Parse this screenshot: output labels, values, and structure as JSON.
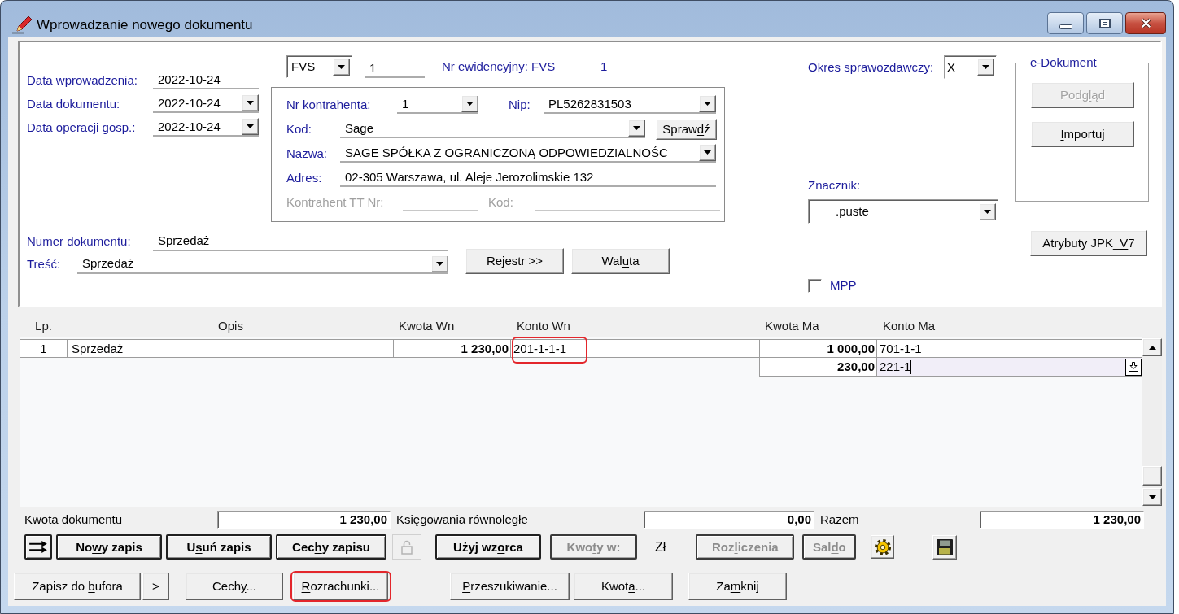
{
  "window": {
    "title": "Wprowadzanie nowego dokumentu"
  },
  "header": {
    "dates": [
      {
        "label": "Data wprowadzenia:",
        "value": "2022-10-24",
        "dropdown": false
      },
      {
        "label": "Data dokumentu:",
        "value": "2022-10-24",
        "dropdown": true
      },
      {
        "label": "Data operacji gosp.:",
        "value": "2022-10-24",
        "dropdown": true
      }
    ],
    "document_type": {
      "value": "FVS"
    },
    "document_no": {
      "value": "1"
    },
    "registry": {
      "label": "Nr ewidencyjny: FVS",
      "value": "1"
    },
    "contractor": {
      "number": {
        "label": "Nr kontrahenta:",
        "value": "1",
        "dropdown": true
      },
      "nip": {
        "label": "Nip:",
        "value": "PL5262831503",
        "dropdown": true
      },
      "code": {
        "label": "Kod:",
        "value": "Sage",
        "dropdown": true
      },
      "check_button": {
        "label": "Sprawdź"
      },
      "name": {
        "label": "Nazwa:",
        "value": "SAGE SPÓŁKA Z OGRANICZONĄ ODPOWIEDZIALNOŚC",
        "dropdown": true
      },
      "address": {
        "label": "Adres:",
        "value": "02-305 Warszawa, ul. Aleje Jerozolimskie 132",
        "dropdown": false
      },
      "tt_number": {
        "label": "Kontrahent TT Nr:",
        "disabled": true
      },
      "tt_code": {
        "label": "Kod:",
        "disabled": true
      }
    },
    "document_number": {
      "label": "Numer dokumentu:",
      "value": "Sprzedaż"
    },
    "content": {
      "label": "Treść:",
      "value": "Sprzedaż",
      "dropdown": true
    },
    "buttons": [
      {
        "label": "Rejestr >>"
      },
      {
        "label": "Waluta"
      }
    ],
    "period": {
      "label": "Okres sprawozdawczy:",
      "value": "X"
    },
    "e_document": {
      "title": "e-Dokument",
      "buttons": [
        {
          "label": "Podgląd",
          "disabled": true
        },
        {
          "label": "Importuj",
          "disabled": false
        }
      ]
    },
    "marker": {
      "label": "Znacznik:",
      "value": ".puste"
    },
    "jpk_button": {
      "label": "Atrybuty JPK_V7"
    },
    "mpp": {
      "label": "MPP",
      "checked": false
    }
  },
  "table": {
    "columns": [
      "Lp.",
      "Opis",
      "Kwota Wn",
      "Konto Wn",
      "Kwota Ma",
      "Konto Ma"
    ],
    "rows": [
      {
        "lp": "1",
        "opis": "Sprzedaż",
        "kwota_wn": "1 230,00",
        "konto_wn": "201-1-1-1",
        "highlighted": true,
        "credits": [
          {
            "kwota_ma": "1 000,00",
            "konto_ma": "701-1-1",
            "editing": false
          },
          {
            "kwota_ma": "230,00",
            "konto_ma": "221-1",
            "editing": true
          }
        ]
      }
    ]
  },
  "totals": [
    {
      "label": "Kwota dokumentu",
      "value": "1 230,00"
    },
    {
      "label": "Księgowania równoległe",
      "value": "0,00"
    },
    {
      "label": "Razem",
      "value": "1 230,00"
    }
  ],
  "toolbar": {
    "record_buttons": [
      {
        "label": "Nowy zapis",
        "disabled": false
      },
      {
        "label": "Usuń zapis",
        "disabled": false
      },
      {
        "label": "Cechy zapisu",
        "disabled": false
      }
    ],
    "lock": {
      "disabled": true
    },
    "template_button": {
      "label": "Użyj wzorca",
      "disabled": false
    },
    "amounts_button": {
      "label": "Kwoty w:",
      "disabled": true
    },
    "currency": "Zł",
    "settlement_buttons": [
      {
        "label": "Rozliczenia",
        "disabled": true
      },
      {
        "label": "Saldo",
        "disabled": true
      }
    ]
  },
  "footer_buttons": [
    {
      "label": "Zapisz do bufora",
      "highlighted": false
    },
    {
      "label": ">",
      "highlighted": false
    },
    {
      "label": "Cechy...",
      "highlighted": false
    },
    {
      "label": "Rozrachunki...",
      "highlighted": true
    },
    {
      "label": "Przeszukiwanie...",
      "highlighted": false
    },
    {
      "label": "Kwota...",
      "highlighted": false
    },
    {
      "label": "Zamknij",
      "highlighted": false
    }
  ]
}
